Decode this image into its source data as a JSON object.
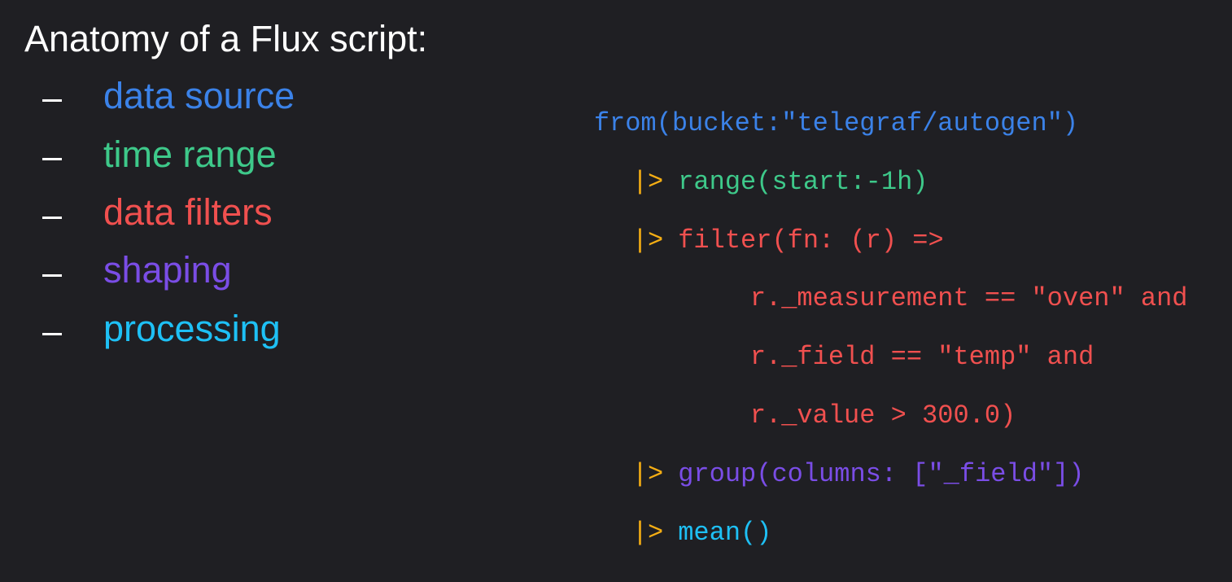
{
  "slide": {
    "title": "Anatomy of a Flux script:"
  },
  "bullets": [
    {
      "dash": "-",
      "label": "data source",
      "color": "#3b82e8"
    },
    {
      "dash": "-",
      "label": "time range",
      "color": "#3ec98a"
    },
    {
      "dash": "-",
      "label": "data filters",
      "color": "#f0504f"
    },
    {
      "dash": "-",
      "label": "shaping",
      "color": "#7a4de6"
    },
    {
      "dash": "-",
      "label": "processing",
      "color": "#1ec0f5"
    }
  ],
  "code": {
    "pipe_color": "#f5ae14",
    "lines": [
      {
        "pipe": "",
        "text": "from(bucket:\"telegraf/autogen\")",
        "color": "#3b82e8"
      },
      {
        "pipe": "|>",
        "text": "range(start:-1h)",
        "color": "#3ec98a"
      },
      {
        "pipe": "|>",
        "text": "filter(fn: (r) =>",
        "color": "#f0504f"
      },
      {
        "pipe": "",
        "text": "r._measurement == \"oven\" and",
        "color": "#f0504f"
      },
      {
        "pipe": "",
        "text": "r._field == \"temp\" and",
        "color": "#f0504f"
      },
      {
        "pipe": "",
        "text": "r._value > 300.0)",
        "color": "#f0504f"
      },
      {
        "pipe": "|>",
        "text": "group(columns: [\"_field\"])",
        "color": "#7a4de6"
      },
      {
        "pipe": "|>",
        "text": "mean()",
        "color": "#1ec0f5"
      }
    ]
  }
}
